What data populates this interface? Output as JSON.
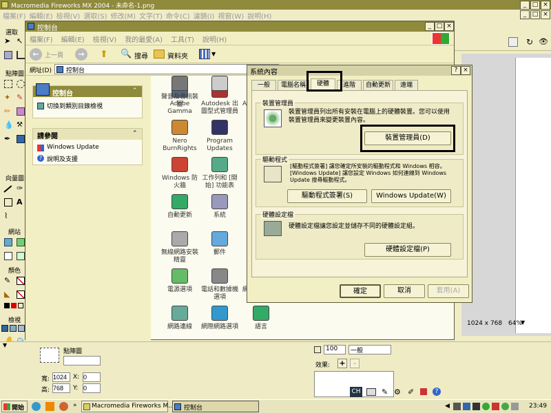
{
  "fireworks": {
    "title": "Macromedia Fireworks MX 2004 - 未命名-1.png",
    "menu": [
      "檔案(F)",
      "編輯(E)",
      "檢視(V)",
      "選取(S)",
      "修改(M)",
      "文字(T)",
      "命令(C)",
      "濾鏡(I)",
      "視窗(W)",
      "說明(H)"
    ],
    "tools": {
      "select": "選取",
      "bitmap": "點陣圖",
      "vector": "向量圖",
      "web": "網站",
      "colors": "顏色",
      "view": "檢視"
    },
    "status_size": "1024 x 768",
    "zoom": "64%"
  },
  "props": {
    "label": "點陣圖",
    "w_label": "寬:",
    "w_value": "1024",
    "h_label": "高:",
    "h_value": "768",
    "x_label": "X:",
    "x_value": "0",
    "y_label": "Y:",
    "y_value": "0",
    "opacity": "100",
    "blend": "一般",
    "effects_label": "效果:",
    "add": "+",
    "remove": "-"
  },
  "control_panel": {
    "title": "控制台",
    "menu": [
      "檔案(F)",
      "編輯(E)",
      "檢視(V)",
      "我的最愛(A)",
      "工具(T)",
      "說明(H)"
    ],
    "back": "上一頁",
    "search": "搜尋",
    "folders": "資料夾",
    "address_label": "網址(D)",
    "address": "控制台",
    "side1_title": "控制台",
    "side1_link": "切換到類別目錄檢視",
    "side2_title": "請參閱",
    "side2_links": [
      "Windows Update",
      "說明及支援"
    ],
    "items": [
      {
        "label": "Adobe Gamma",
        "icon": "monitor-icon"
      },
      {
        "label": "Autodesk 出圖型式管理員",
        "icon": "autodesk-icon"
      },
      {
        "label": "Autodesk 繪",
        "icon": "autodesk-icon"
      },
      {
        "label": "Nero BurnRights",
        "icon": "nero-icon"
      },
      {
        "label": "Program Updates",
        "icon": "update-icon"
      },
      {
        "label": "Qu",
        "icon": "quicktime-icon"
      },
      {
        "label": "Windows 防火牆",
        "icon": "firewall-icon"
      },
      {
        "label": "工作列和 [開始] 功能表",
        "icon": "taskbar-icon"
      },
      {
        "label": "日期",
        "icon": "calendar-icon"
      },
      {
        "label": "自動更新",
        "icon": "globe-icon"
      },
      {
        "label": "系統",
        "icon": "computer-icon"
      },
      {
        "label": "系統",
        "icon": "folder-icon"
      },
      {
        "label": "無線網路安裝精靈",
        "icon": "wireless-icon"
      },
      {
        "label": "郵件",
        "icon": "mail-icon"
      },
      {
        "label": "新增",
        "icon": "add-icon"
      },
      {
        "label": "電源選項",
        "icon": "power-icon"
      },
      {
        "label": "電話和數據機選項",
        "icon": "phone-icon"
      },
      {
        "label": "網路安裝精靈",
        "icon": "network-icon"
      },
      {
        "label": "網路連線",
        "icon": "network-icon"
      },
      {
        "label": "網際網路選項",
        "icon": "ie-icon"
      },
      {
        "label": "語言",
        "icon": "globe-icon"
      },
      {
        "label": "聲音及音訊裝置",
        "icon": "speaker-icon"
      },
      {
        "label": "",
        "icon": "mouse-icon"
      },
      {
        "label": "",
        "icon": "user-icon"
      }
    ]
  },
  "dialog": {
    "title": "系統內容",
    "help": "?",
    "tabs": [
      "一般",
      "電腦名稱",
      "硬體",
      "進階",
      "自動更新",
      "遠端"
    ],
    "active_tab": 2,
    "g1_title": "裝置管理員",
    "g1_text": "裝置管理員列出所有安裝在電腦上的硬體裝置。您可以使用裝置管理員來變更裝置內容。",
    "g1_button": "裝置管理員(D)",
    "g2_title": "驅動程式",
    "g2_text": "[驅動程式簽署] 讓您確定所安裝的驅動程式和 Windows 相容。[Windows Update] 讓您設定 Windows 如何連線到 Windows Update 搜尋驅動程式。",
    "g2_button1": "驅動程式簽署(S)",
    "g2_button2": "Windows Update(W)",
    "g3_title": "硬體設定檔",
    "g3_text": "硬體設定檔讓您設定並儲存不同的硬體設定組。",
    "g3_button": "硬體設定檔(P)",
    "ok": "確定",
    "cancel": "取消",
    "apply": "套用(A)"
  },
  "taskbar": {
    "start": "開始",
    "task1": "Macromedia Fireworks M...",
    "task2": "控制台",
    "lang": "CH",
    "time": "23:49"
  },
  "colors": {
    "titlebar": "#8f8a3c",
    "bg": "#f3efc4",
    "highlight": "#000000"
  }
}
